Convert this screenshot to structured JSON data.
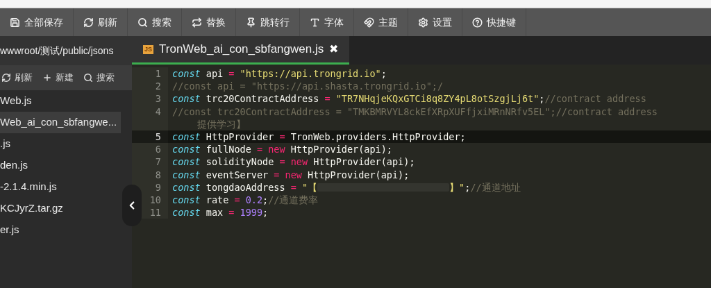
{
  "toolbar": [
    {
      "label": "全部保存"
    },
    {
      "label": "刷新"
    },
    {
      "label": "搜索"
    },
    {
      "label": "替换"
    },
    {
      "label": "跳转行"
    },
    {
      "label": "字体"
    },
    {
      "label": "主题"
    },
    {
      "label": "设置"
    },
    {
      "label": "快捷键"
    }
  ],
  "sidebar": {
    "path": "wwwroot/测试/public/jsons",
    "actions": [
      {
        "label": "刷新"
      },
      {
        "label": "新建"
      },
      {
        "label": "搜索"
      }
    ],
    "files": [
      {
        "name": "Web.js",
        "selected": false
      },
      {
        "name": "Web_ai_con_sbfangwe...",
        "selected": true
      },
      {
        "name": ".js",
        "selected": false
      },
      {
        "name": "den.js",
        "selected": false
      },
      {
        "name": "-2.1.4.min.js",
        "selected": false
      },
      {
        "name": "KCJyrZ.tar.gz",
        "selected": false
      },
      {
        "name": "er.js",
        "selected": false
      }
    ]
  },
  "tabs": [
    {
      "badge": "JS",
      "title": "TronWeb_ai_con_sbfangwen.js",
      "close": "✖",
      "selected": true
    }
  ],
  "editor": {
    "lines": [
      {
        "number": "1",
        "active": false,
        "tokens": [
          {
            "kind": "keyword",
            "text": "const"
          },
          {
            "kind": "ident",
            "text": " api "
          },
          {
            "kind": "op",
            "text": "="
          },
          {
            "kind": "string",
            "text": " \"https://api.trongrid.io\""
          },
          {
            "kind": "ident",
            "text": ";"
          }
        ]
      },
      {
        "number": "2",
        "active": false,
        "tokens": [
          {
            "kind": "comment",
            "text": "//const api = \"https://api.shasta.trongrid.io\";/"
          }
        ]
      },
      {
        "number": "3",
        "active": false,
        "tokens": [
          {
            "kind": "keyword",
            "text": "const"
          },
          {
            "kind": "ident",
            "text": " trc20ContractAddress "
          },
          {
            "kind": "op",
            "text": "="
          },
          {
            "kind": "string",
            "text": " \"TR7NHqjeKQxGTCi8q8ZY4pL8otSzgjLj6t\""
          },
          {
            "kind": "ident",
            "text": ";"
          },
          {
            "kind": "comment",
            "text": "//contract address"
          }
        ]
      },
      {
        "number": "4",
        "active": false,
        "tokens": [
          {
            "kind": "comment",
            "text": "//const trc20ContractAddress = \"TMKBMRVYL8ckEfXRpXUFfjxiMRnNRfv5EL\";//contract address"
          }
        ],
        "continuation": "提供学习】"
      },
      {
        "number": "5",
        "active": true,
        "tokens": [
          {
            "kind": "keyword",
            "text": "const"
          },
          {
            "kind": "ident",
            "text": " HttpProvider "
          },
          {
            "kind": "op",
            "text": "="
          },
          {
            "kind": "ident",
            "text": " TronWeb.providers.HttpProvider;"
          }
        ]
      },
      {
        "number": "6",
        "active": false,
        "tokens": [
          {
            "kind": "keyword",
            "text": "const"
          },
          {
            "kind": "ident",
            "text": " fullNode "
          },
          {
            "kind": "op",
            "text": "= new"
          },
          {
            "kind": "ident",
            "text": " HttpProvider(api);"
          }
        ]
      },
      {
        "number": "7",
        "active": false,
        "tokens": [
          {
            "kind": "keyword",
            "text": "const"
          },
          {
            "kind": "ident",
            "text": " solidityNode "
          },
          {
            "kind": "op",
            "text": "= new"
          },
          {
            "kind": "ident",
            "text": " HttpProvider(api);"
          }
        ]
      },
      {
        "number": "8",
        "active": false,
        "tokens": [
          {
            "kind": "keyword",
            "text": "const"
          },
          {
            "kind": "ident",
            "text": " eventServer "
          },
          {
            "kind": "op",
            "text": "= new"
          },
          {
            "kind": "ident",
            "text": " HttpProvider(api);"
          }
        ]
      },
      {
        "number": "9",
        "active": false,
        "tokens": [
          {
            "kind": "keyword",
            "text": "const"
          },
          {
            "kind": "ident",
            "text": " tongdaoAddress "
          },
          {
            "kind": "op",
            "text": "="
          },
          {
            "kind": "string",
            "text": " \"【"
          },
          {
            "kind": "redacted"
          },
          {
            "kind": "string",
            "text": "】\""
          },
          {
            "kind": "ident",
            "text": ";"
          },
          {
            "kind": "comment",
            "text": "//通道地址"
          }
        ]
      },
      {
        "number": "10",
        "active": false,
        "tokens": [
          {
            "kind": "keyword",
            "text": "const"
          },
          {
            "kind": "ident",
            "text": " rate "
          },
          {
            "kind": "op",
            "text": "="
          },
          {
            "kind": "number",
            "text": " 0.2"
          },
          {
            "kind": "ident",
            "text": ";"
          },
          {
            "kind": "comment",
            "text": "//通道费率"
          }
        ]
      },
      {
        "number": "11",
        "active": false,
        "tokens": [
          {
            "kind": "keyword",
            "text": "const"
          },
          {
            "kind": "ident",
            "text": " max "
          },
          {
            "kind": "op",
            "text": "="
          },
          {
            "kind": "number",
            "text": " 1999"
          },
          {
            "kind": "ident",
            "text": ";"
          }
        ]
      }
    ]
  }
}
